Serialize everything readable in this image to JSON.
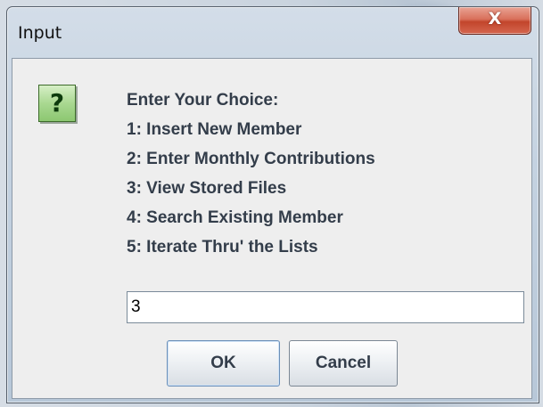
{
  "window": {
    "title": "Input",
    "close_glyph": "X"
  },
  "dialog": {
    "icon": "question-icon",
    "icon_glyph": "?",
    "lines": [
      "Enter Your Choice:",
      "1: Insert New Member",
      "2: Enter Monthly Contributions",
      "3: View Stored Files",
      "4: Search Existing Member",
      "5: Iterate Thru' the Lists"
    ],
    "input_value": "3"
  },
  "buttons": {
    "ok_label": "OK",
    "cancel_label": "Cancel"
  },
  "colors": {
    "close_button": "#c2452b",
    "dialog_background": "#eeeeee",
    "icon_background": "#a9d891",
    "text": "#333d4a"
  }
}
